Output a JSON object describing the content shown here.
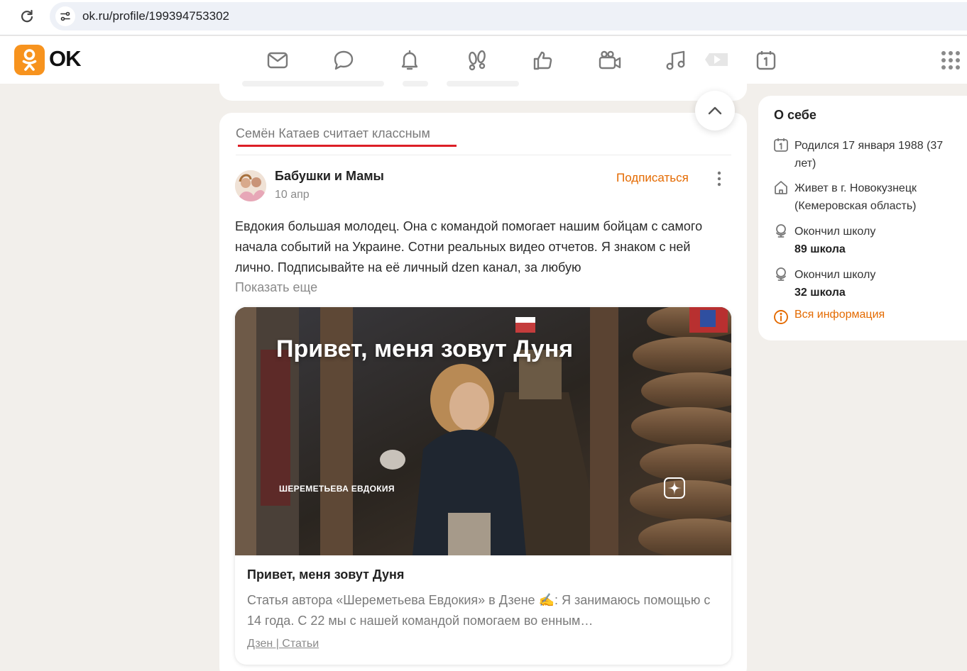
{
  "browser": {
    "url": "ok.ru/profile/199394753302",
    "reload_icon": "reload-icon",
    "site_info_icon": "site-settings-icon"
  },
  "header": {
    "logo_text": "OK",
    "brand_color": "#f7931e",
    "nav_icons": [
      "mail-icon",
      "chat-icon",
      "bell-icon",
      "guests-icon",
      "like-icon",
      "video-camera-icon",
      "music-icon",
      "video-play-icon",
      "calendar-icon"
    ],
    "apps_icon": "apps-grid-icon"
  },
  "feed": {
    "event_title": "Семён Катаев считает классным",
    "accent_color": "#dc1f26",
    "post": {
      "group_name": "Бабушки и Мамы",
      "date": "10 апр",
      "subscribe_label": "Подписаться",
      "text": "Евдокия большая молодец. Она с командой помогает нашим бойцам с самого начала событий на Украине. Сотни реальных видео отчетов. Я знаком с ней лично. Подписывайте на её личный dzen канал, за любую",
      "show_more": "Показать еще",
      "article": {
        "image_title": "Привет, меня зовут Дуня",
        "image_author": "ШЕРЕМЕТЬЕВА ЕВДОКИЯ",
        "title": "Привет, меня зовут Дуня",
        "description": "Статья автора «Шереметьева Евдокия» в Дзене ✍️: Я занимаюсь помощью с 14 года. С 22 мы с нашей командой помогаем во енным…",
        "source": "Дзен | Статьи"
      }
    }
  },
  "about": {
    "title": "О себе",
    "items": [
      {
        "icon": "calendar-icon",
        "text": "Родился 17 января 1988 (37 лет)",
        "strong": ""
      },
      {
        "icon": "home-icon",
        "text": "Живет в г. Новокузнецк (Кемеровская область)",
        "strong": ""
      },
      {
        "icon": "globe-icon",
        "text": "Окончил школу",
        "strong": "89 школа"
      },
      {
        "icon": "globe-icon",
        "text": "Окончил школу",
        "strong": "32 школа"
      }
    ],
    "all_info": "Вся информация",
    "link_color": "#e46a00"
  }
}
